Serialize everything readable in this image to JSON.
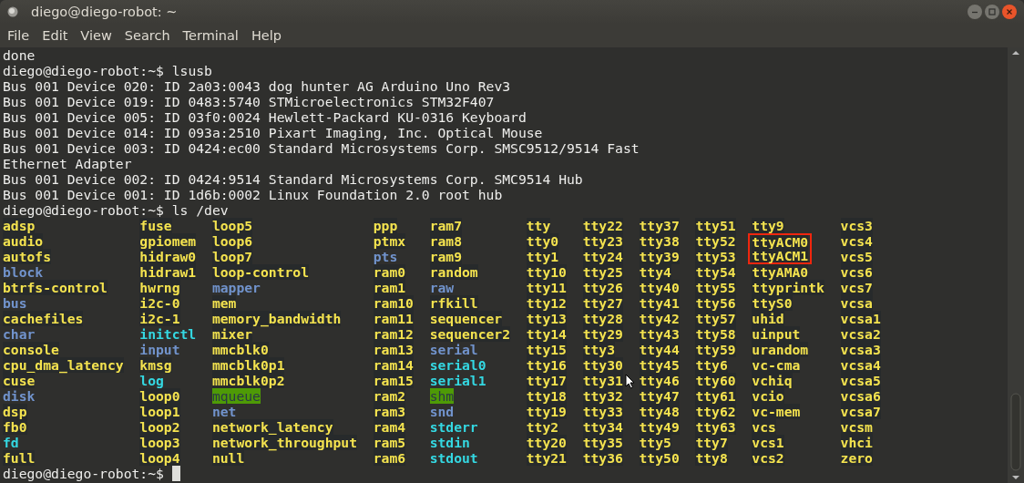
{
  "window": {
    "title": "diego@diego-robot: ~"
  },
  "menu": [
    "File",
    "Edit",
    "View",
    "Search",
    "Terminal",
    "Help"
  ],
  "terminal": {
    "lines": [
      {
        "kind": "output",
        "text": "done"
      },
      {
        "kind": "prompt",
        "prompt": "diego@diego-robot:~$",
        "command": "lsusb"
      },
      {
        "kind": "output",
        "text": "Bus 001 Device 020: ID 2a03:0043 dog hunter AG Arduino Uno Rev3"
      },
      {
        "kind": "output",
        "text": "Bus 001 Device 019: ID 0483:5740 STMicroelectronics STM32F407"
      },
      {
        "kind": "output",
        "text": "Bus 001 Device 005: ID 03f0:0024 Hewlett-Packard KU-0316 Keyboard"
      },
      {
        "kind": "output",
        "text": "Bus 001 Device 014: ID 093a:2510 Pixart Imaging, Inc. Optical Mouse"
      },
      {
        "kind": "output",
        "text": "Bus 001 Device 003: ID 0424:ec00 Standard Microsystems Corp. SMSC9512/9514 Fast"
      },
      {
        "kind": "output",
        "text": "Ethernet Adapter"
      },
      {
        "kind": "output",
        "text": "Bus 001 Device 002: ID 0424:9514 Standard Microsystems Corp. SMC9514 Hub"
      },
      {
        "kind": "output",
        "text": "Bus 001 Device 001: ID 1d6b:0002 Linux Foundation 2.0 root hub"
      },
      {
        "kind": "prompt",
        "prompt": "diego@diego-robot:~$",
        "command": "ls /dev"
      },
      {
        "kind": "listing",
        "columns": [
          [
            {
              "name": "adsp",
              "kind": "device"
            },
            {
              "name": "audio",
              "kind": "device"
            },
            {
              "name": "autofs",
              "kind": "device"
            },
            {
              "name": "block",
              "kind": "dir"
            },
            {
              "name": "btrfs-control",
              "kind": "device"
            },
            {
              "name": "bus",
              "kind": "dir"
            },
            {
              "name": "cachefiles",
              "kind": "device"
            },
            {
              "name": "char",
              "kind": "dir"
            },
            {
              "name": "console",
              "kind": "device"
            },
            {
              "name": "cpu_dma_latency",
              "kind": "device"
            },
            {
              "name": "cuse",
              "kind": "device"
            },
            {
              "name": "disk",
              "kind": "dir"
            },
            {
              "name": "dsp",
              "kind": "device"
            },
            {
              "name": "fb0",
              "kind": "device"
            },
            {
              "name": "fd",
              "kind": "link"
            },
            {
              "name": "full",
              "kind": "device"
            }
          ],
          [
            {
              "name": "fuse",
              "kind": "device"
            },
            {
              "name": "gpiomem",
              "kind": "device"
            },
            {
              "name": "hidraw0",
              "kind": "device"
            },
            {
              "name": "hidraw1",
              "kind": "device"
            },
            {
              "name": "hwrng",
              "kind": "device"
            },
            {
              "name": "i2c-0",
              "kind": "device"
            },
            {
              "name": "i2c-1",
              "kind": "device"
            },
            {
              "name": "initctl",
              "kind": "link"
            },
            {
              "name": "input",
              "kind": "dir"
            },
            {
              "name": "kmsg",
              "kind": "device"
            },
            {
              "name": "log",
              "kind": "link"
            },
            {
              "name": "loop0",
              "kind": "device"
            },
            {
              "name": "loop1",
              "kind": "device"
            },
            {
              "name": "loop2",
              "kind": "device"
            },
            {
              "name": "loop3",
              "kind": "device"
            },
            {
              "name": "loop4",
              "kind": "device"
            }
          ],
          [
            {
              "name": "loop5",
              "kind": "device"
            },
            {
              "name": "loop6",
              "kind": "device"
            },
            {
              "name": "loop7",
              "kind": "device"
            },
            {
              "name": "loop-control",
              "kind": "device"
            },
            {
              "name": "mapper",
              "kind": "dir"
            },
            {
              "name": "mem",
              "kind": "device"
            },
            {
              "name": "memory_bandwidth",
              "kind": "device"
            },
            {
              "name": "mixer",
              "kind": "device"
            },
            {
              "name": "mmcblk0",
              "kind": "device"
            },
            {
              "name": "mmcblk0p1",
              "kind": "device"
            },
            {
              "name": "mmcblk0p2",
              "kind": "device"
            },
            {
              "name": "mqueue",
              "kind": "sticky"
            },
            {
              "name": "net",
              "kind": "dir"
            },
            {
              "name": "network_latency",
              "kind": "device"
            },
            {
              "name": "network_throughput",
              "kind": "device"
            },
            {
              "name": "null",
              "kind": "device"
            }
          ],
          [
            {
              "name": "ppp",
              "kind": "device"
            },
            {
              "name": "ptmx",
              "kind": "device"
            },
            {
              "name": "pts",
              "kind": "dir"
            },
            {
              "name": "ram0",
              "kind": "device"
            },
            {
              "name": "ram1",
              "kind": "device"
            },
            {
              "name": "ram10",
              "kind": "device"
            },
            {
              "name": "ram11",
              "kind": "device"
            },
            {
              "name": "ram12",
              "kind": "device"
            },
            {
              "name": "ram13",
              "kind": "device"
            },
            {
              "name": "ram14",
              "kind": "device"
            },
            {
              "name": "ram15",
              "kind": "device"
            },
            {
              "name": "ram2",
              "kind": "device"
            },
            {
              "name": "ram3",
              "kind": "device"
            },
            {
              "name": "ram4",
              "kind": "device"
            },
            {
              "name": "ram5",
              "kind": "device"
            },
            {
              "name": "ram6",
              "kind": "device"
            }
          ],
          [
            {
              "name": "ram7",
              "kind": "device"
            },
            {
              "name": "ram8",
              "kind": "device"
            },
            {
              "name": "ram9",
              "kind": "device"
            },
            {
              "name": "random",
              "kind": "device"
            },
            {
              "name": "raw",
              "kind": "dir"
            },
            {
              "name": "rfkill",
              "kind": "device"
            },
            {
              "name": "sequencer",
              "kind": "device"
            },
            {
              "name": "sequencer2",
              "kind": "device"
            },
            {
              "name": "serial",
              "kind": "dir"
            },
            {
              "name": "serial0",
              "kind": "link"
            },
            {
              "name": "serial1",
              "kind": "link"
            },
            {
              "name": "shm",
              "kind": "sticky"
            },
            {
              "name": "snd",
              "kind": "dir"
            },
            {
              "name": "stderr",
              "kind": "link"
            },
            {
              "name": "stdin",
              "kind": "link"
            },
            {
              "name": "stdout",
              "kind": "link"
            }
          ],
          [
            {
              "name": "tty",
              "kind": "device"
            },
            {
              "name": "tty0",
              "kind": "device"
            },
            {
              "name": "tty1",
              "kind": "device"
            },
            {
              "name": "tty10",
              "kind": "device"
            },
            {
              "name": "tty11",
              "kind": "device"
            },
            {
              "name": "tty12",
              "kind": "device"
            },
            {
              "name": "tty13",
              "kind": "device"
            },
            {
              "name": "tty14",
              "kind": "device"
            },
            {
              "name": "tty15",
              "kind": "device"
            },
            {
              "name": "tty16",
              "kind": "device"
            },
            {
              "name": "tty17",
              "kind": "device"
            },
            {
              "name": "tty18",
              "kind": "device"
            },
            {
              "name": "tty19",
              "kind": "device"
            },
            {
              "name": "tty2",
              "kind": "device"
            },
            {
              "name": "tty20",
              "kind": "device"
            },
            {
              "name": "tty21",
              "kind": "device"
            }
          ],
          [
            {
              "name": "tty22",
              "kind": "device"
            },
            {
              "name": "tty23",
              "kind": "device"
            },
            {
              "name": "tty24",
              "kind": "device"
            },
            {
              "name": "tty25",
              "kind": "device"
            },
            {
              "name": "tty26",
              "kind": "device"
            },
            {
              "name": "tty27",
              "kind": "device"
            },
            {
              "name": "tty28",
              "kind": "device"
            },
            {
              "name": "tty29",
              "kind": "device"
            },
            {
              "name": "tty3",
              "kind": "device"
            },
            {
              "name": "tty30",
              "kind": "device"
            },
            {
              "name": "tty31",
              "kind": "device",
              "pointer": true
            },
            {
              "name": "tty32",
              "kind": "device"
            },
            {
              "name": "tty33",
              "kind": "device"
            },
            {
              "name": "tty34",
              "kind": "device"
            },
            {
              "name": "tty35",
              "kind": "device"
            },
            {
              "name": "tty36",
              "kind": "device"
            }
          ],
          [
            {
              "name": "tty37",
              "kind": "device"
            },
            {
              "name": "tty38",
              "kind": "device"
            },
            {
              "name": "tty39",
              "kind": "device"
            },
            {
              "name": "tty4",
              "kind": "device"
            },
            {
              "name": "tty40",
              "kind": "device"
            },
            {
              "name": "tty41",
              "kind": "device"
            },
            {
              "name": "tty42",
              "kind": "device"
            },
            {
              "name": "tty43",
              "kind": "device"
            },
            {
              "name": "tty44",
              "kind": "device"
            },
            {
              "name": "tty45",
              "kind": "device"
            },
            {
              "name": "tty46",
              "kind": "device"
            },
            {
              "name": "tty47",
              "kind": "device"
            },
            {
              "name": "tty48",
              "kind": "device"
            },
            {
              "name": "tty49",
              "kind": "device"
            },
            {
              "name": "tty5",
              "kind": "device"
            },
            {
              "name": "tty50",
              "kind": "device"
            }
          ],
          [
            {
              "name": "tty51",
              "kind": "device"
            },
            {
              "name": "tty52",
              "kind": "device"
            },
            {
              "name": "tty53",
              "kind": "device"
            },
            {
              "name": "tty54",
              "kind": "device"
            },
            {
              "name": "tty55",
              "kind": "device"
            },
            {
              "name": "tty56",
              "kind": "device"
            },
            {
              "name": "tty57",
              "kind": "device"
            },
            {
              "name": "tty58",
              "kind": "device"
            },
            {
              "name": "tty59",
              "kind": "device"
            },
            {
              "name": "tty6",
              "kind": "device"
            },
            {
              "name": "tty60",
              "kind": "device"
            },
            {
              "name": "tty61",
              "kind": "device"
            },
            {
              "name": "tty62",
              "kind": "device"
            },
            {
              "name": "tty63",
              "kind": "device"
            },
            {
              "name": "tty7",
              "kind": "device"
            },
            {
              "name": "tty8",
              "kind": "device"
            }
          ],
          [
            {
              "name": "tty9",
              "kind": "device"
            },
            {
              "name": "ttyACM0",
              "kind": "device",
              "highlighted": true
            },
            {
              "name": "ttyACM1",
              "kind": "device",
              "highlighted": true
            },
            {
              "name": "ttyAMA0",
              "kind": "device"
            },
            {
              "name": "ttyprintk",
              "kind": "device"
            },
            {
              "name": "ttyS0",
              "kind": "device"
            },
            {
              "name": "uhid",
              "kind": "device"
            },
            {
              "name": "uinput",
              "kind": "device"
            },
            {
              "name": "urandom",
              "kind": "device"
            },
            {
              "name": "vc-cma",
              "kind": "device"
            },
            {
              "name": "vchiq",
              "kind": "device"
            },
            {
              "name": "vcio",
              "kind": "device"
            },
            {
              "name": "vc-mem",
              "kind": "device"
            },
            {
              "name": "vcs",
              "kind": "device"
            },
            {
              "name": "vcs1",
              "kind": "device"
            },
            {
              "name": "vcs2",
              "kind": "device"
            }
          ],
          [
            {
              "name": "vcs3",
              "kind": "device"
            },
            {
              "name": "vcs4",
              "kind": "device"
            },
            {
              "name": "vcs5",
              "kind": "device"
            },
            {
              "name": "vcs6",
              "kind": "device"
            },
            {
              "name": "vcs7",
              "kind": "device"
            },
            {
              "name": "vcsa",
              "kind": "device"
            },
            {
              "name": "vcsa1",
              "kind": "device"
            },
            {
              "name": "vcsa2",
              "kind": "device"
            },
            {
              "name": "vcsa3",
              "kind": "device"
            },
            {
              "name": "vcsa4",
              "kind": "device"
            },
            {
              "name": "vcsa5",
              "kind": "device"
            },
            {
              "name": "vcsa6",
              "kind": "device"
            },
            {
              "name": "vcsa7",
              "kind": "device"
            },
            {
              "name": "vcsm",
              "kind": "device"
            },
            {
              "name": "vhci",
              "kind": "device"
            },
            {
              "name": "zero",
              "kind": "device"
            }
          ]
        ]
      },
      {
        "kind": "prompt",
        "prompt": "diego@diego-robot:~$",
        "cursor": true
      }
    ]
  }
}
